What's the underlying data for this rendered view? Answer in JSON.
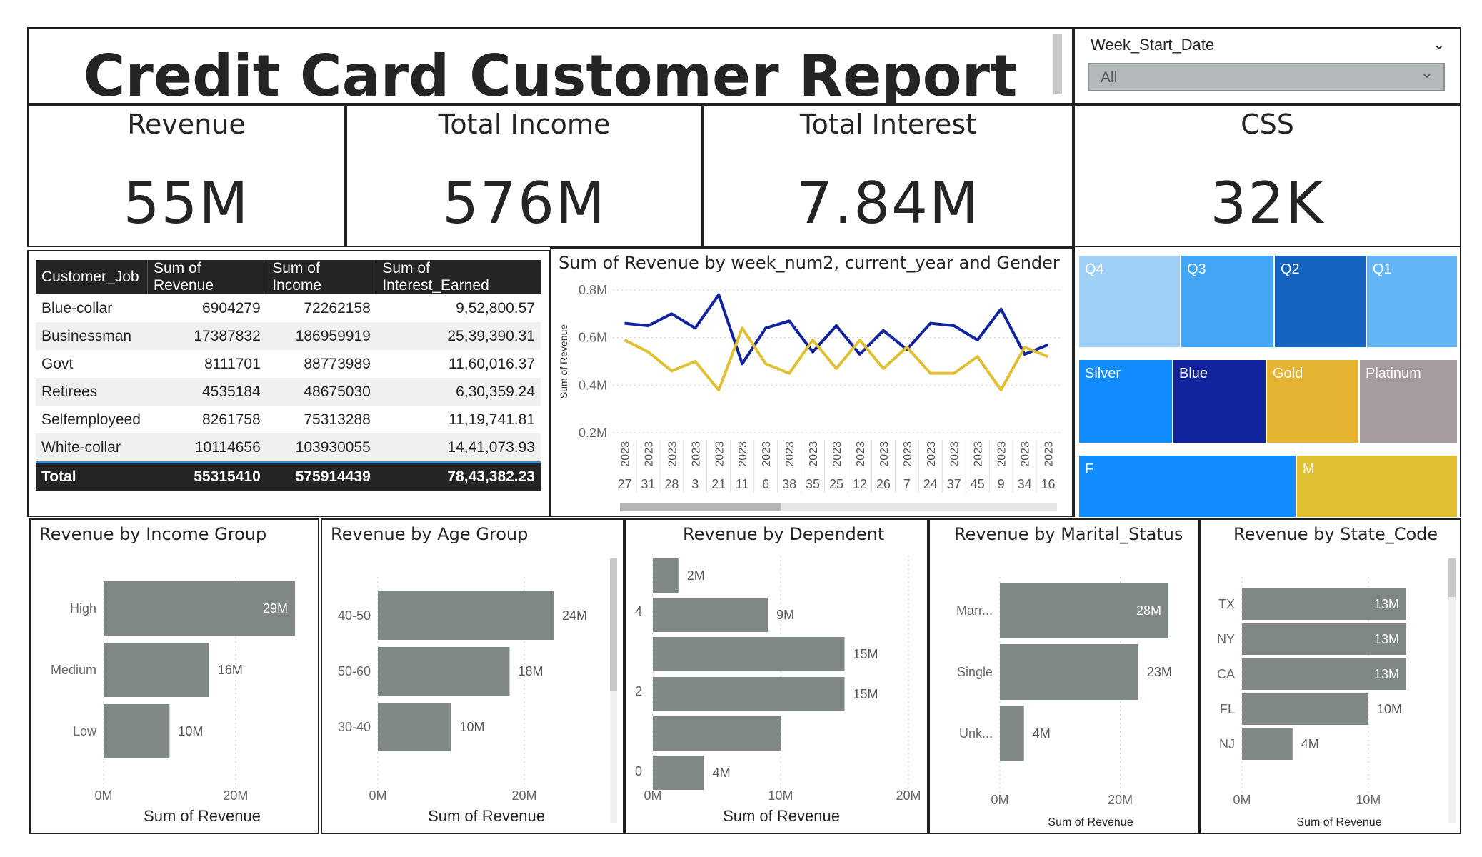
{
  "header": {
    "title": "Credit Card Customer Report"
  },
  "slicer": {
    "label": "Week_Start_Date",
    "value": "All"
  },
  "kpis": [
    {
      "label": "Revenue",
      "value": "55M"
    },
    {
      "label": "Total Income",
      "value": "576M"
    },
    {
      "label": "Total Interest",
      "value": "7.84M"
    },
    {
      "label": "CSS",
      "value": "32K"
    }
  ],
  "table": {
    "headers": [
      "Customer_Job",
      "Sum of Revenue",
      "Sum of Income",
      "Sum of Interest_Earned"
    ],
    "rows": [
      [
        "Blue-collar",
        "6904279",
        "72262158",
        "9,52,800.57"
      ],
      [
        "Businessman",
        "17387832",
        "186959919",
        "25,39,390.31"
      ],
      [
        "Govt",
        "8111701",
        "88773989",
        "11,60,016.37"
      ],
      [
        "Retirees",
        "4535184",
        "48675030",
        "6,30,359.24"
      ],
      [
        "Selfemployeed",
        "8261758",
        "75313288",
        "11,19,741.81"
      ],
      [
        "White-collar",
        "10114656",
        "103930055",
        "14,41,073.93"
      ]
    ],
    "total": [
      "Total",
      "55315410",
      "575914439",
      "78,43,382.23"
    ]
  },
  "treemap": {
    "quarters": [
      {
        "label": "Q4",
        "color": "#9fd0f7"
      },
      {
        "label": "Q3",
        "color": "#42a5f5"
      },
      {
        "label": "Q2",
        "color": "#1565c0"
      },
      {
        "label": "Q1",
        "color": "#64b5f6"
      }
    ],
    "cards": [
      {
        "label": "Silver",
        "color": "#118dff"
      },
      {
        "label": "Blue",
        "color": "#12239e"
      },
      {
        "label": "Gold",
        "color": "#e6b433"
      },
      {
        "label": "Platinum",
        "color": "#a59ba0"
      }
    ],
    "gender": [
      {
        "label": "F",
        "color": "#118dff"
      },
      {
        "label": "M",
        "color": "#e0c033"
      }
    ]
  },
  "chart_data": [
    {
      "type": "line",
      "title": "Sum of Revenue by week_num2, current_year and Gender",
      "ylabel": "Sum of Revenue",
      "ylim": [
        0.2,
        0.8
      ],
      "yticks": [
        "0.2M",
        "0.4M",
        "0.6M",
        "0.8M"
      ],
      "x_year": "2023",
      "x": [
        "27",
        "31",
        "28",
        "3",
        "21",
        "11",
        "6",
        "38",
        "35",
        "25",
        "12",
        "26",
        "7",
        "24",
        "37",
        "45",
        "9",
        "34",
        "16"
      ],
      "series": [
        {
          "color": "#12239e",
          "values": [
            0.66,
            0.65,
            0.7,
            0.64,
            0.78,
            0.49,
            0.64,
            0.67,
            0.54,
            0.65,
            0.53,
            0.63,
            0.55,
            0.66,
            0.65,
            0.59,
            0.72,
            0.53,
            0.57
          ]
        },
        {
          "color": "#e0c033",
          "values": [
            0.59,
            0.54,
            0.46,
            0.5,
            0.38,
            0.64,
            0.49,
            0.45,
            0.59,
            0.47,
            0.59,
            0.47,
            0.56,
            0.45,
            0.45,
            0.52,
            0.38,
            0.56,
            0.52
          ]
        }
      ]
    },
    {
      "type": "bar",
      "title": "Revenue by Income Group",
      "xlabel": "Sum of Revenue",
      "categories": [
        "High",
        "Medium",
        "Low"
      ],
      "values": [
        29,
        16,
        10
      ],
      "labels": [
        "29M",
        "16M",
        "10M"
      ],
      "xlim": [
        0,
        29
      ],
      "xticks": [
        "0M",
        "20M"
      ]
    },
    {
      "type": "bar",
      "title": "Revenue by Age Group",
      "xlabel": "Sum of Revenue",
      "categories": [
        "40-50",
        "50-60",
        "30-40"
      ],
      "values": [
        24,
        18,
        10
      ],
      "labels": [
        "24M",
        "18M",
        "10M"
      ],
      "xlim": [
        0,
        24
      ],
      "xticks": [
        "0M",
        "20M"
      ]
    },
    {
      "type": "bar",
      "title": "Revenue by Dependent",
      "xlabel": "Sum of Revenue",
      "yticks": [
        "4",
        "2",
        "0"
      ],
      "values": [
        2,
        9,
        15,
        15,
        10,
        4
      ],
      "labels": [
        "2M",
        "9M",
        "15M",
        "15M",
        "",
        "4M"
      ],
      "xlim": [
        0,
        20
      ],
      "xticks": [
        "0M",
        "10M",
        "20M"
      ]
    },
    {
      "type": "bar",
      "title": "Revenue by Marital_Status",
      "xlabel": "Sum of Revenue",
      "categories": [
        "Marr...",
        "Single",
        "Unk..."
      ],
      "values": [
        28,
        23,
        4
      ],
      "labels": [
        "28M",
        "23M",
        "4M"
      ],
      "xlim": [
        0,
        28
      ],
      "xticks": [
        "0M",
        "20M"
      ]
    },
    {
      "type": "bar",
      "title": "Revenue by State_Code",
      "xlabel": "Sum of Revenue",
      "categories": [
        "TX",
        "NY",
        "CA",
        "FL",
        "NJ"
      ],
      "values": [
        13,
        13,
        13,
        10,
        4
      ],
      "labels": [
        "13M",
        "13M",
        "13M",
        "10M",
        "4M"
      ],
      "xlim": [
        0,
        13
      ],
      "xticks": [
        "0M",
        "10M"
      ]
    }
  ]
}
